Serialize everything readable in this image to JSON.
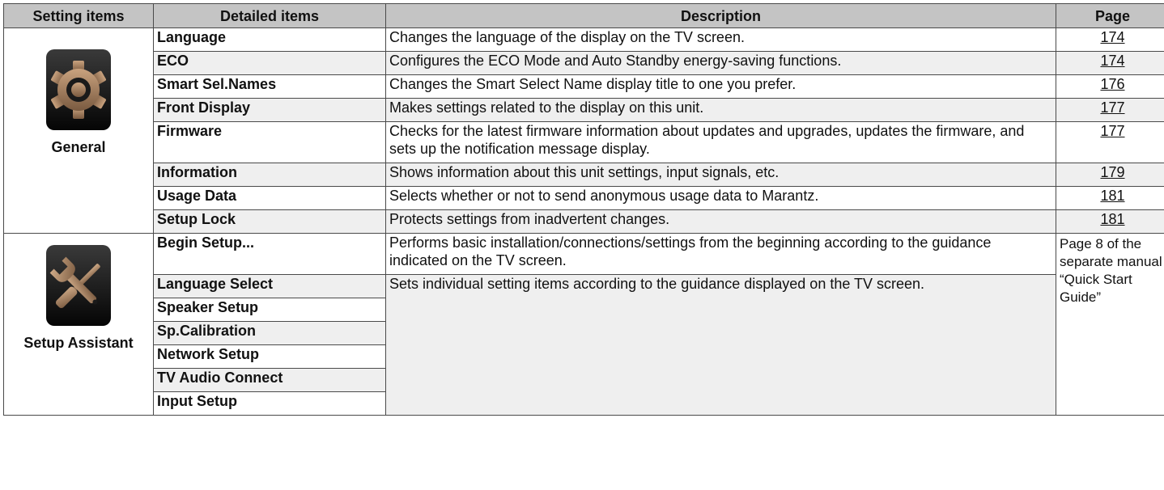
{
  "header": {
    "setting_items": "Setting items",
    "detailed_items": "Detailed items",
    "description": "Description",
    "page": "Page"
  },
  "groups": [
    {
      "label": "General",
      "icon": "gear-icon",
      "rows": [
        {
          "detail": "Language",
          "description": "Changes the language of the display on the TV screen.",
          "page": "174"
        },
        {
          "detail": "ECO",
          "description": "Configures the ECO Mode and Auto Standby energy-saving functions.",
          "page": "174"
        },
        {
          "detail": "Smart Sel.Names",
          "description": "Changes the Smart Select Name display title to one you prefer.",
          "page": "176"
        },
        {
          "detail": "Front Display",
          "description": "Makes settings related to the display on this unit.",
          "page": "177"
        },
        {
          "detail": "Firmware",
          "description": "Checks for the latest firmware information about updates and upgrades, updates the firmware, and sets up the notification message display.",
          "page": "177"
        },
        {
          "detail": "Information",
          "description": "Shows information about this unit settings, input signals, etc.",
          "page": "179"
        },
        {
          "detail": "Usage Data",
          "description": "Selects whether or not to send anonymous usage data to Marantz.",
          "page": "181"
        },
        {
          "detail": "Setup Lock",
          "description": "Protects settings from inadvertent changes.",
          "page": "181"
        }
      ]
    },
    {
      "label": "Setup Assistant",
      "icon": "wrench-screwdriver-icon",
      "rows": [
        {
          "detail": "Begin Setup...",
          "description": "Performs basic installation/connections/settings from the beginning according to the guidance indicated on the TV screen."
        },
        {
          "detail": "Language Select",
          "description": "Sets individual setting items according to the guidance displayed on the TV screen."
        },
        {
          "detail": "Speaker Setup"
        },
        {
          "detail": "Sp.Calibration"
        },
        {
          "detail": "Network Setup"
        },
        {
          "detail": "TV Audio Connect"
        },
        {
          "detail": "Input Setup"
        }
      ],
      "page_note": "Page 8 of the separate manual “Quick Start Guide”"
    }
  ]
}
